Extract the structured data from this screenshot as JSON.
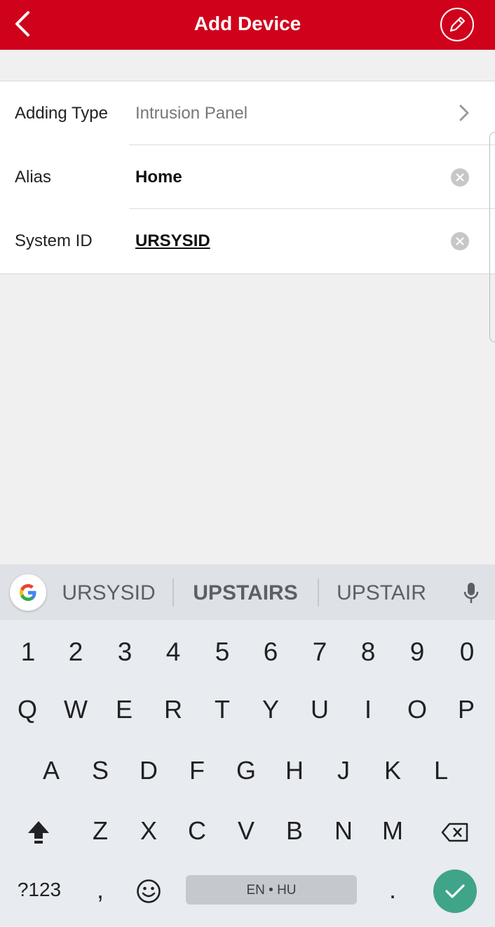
{
  "header": {
    "title": "Add Device",
    "back_icon": "chevron-left-icon",
    "edit_icon": "pencil-icon",
    "color": "#d0021b"
  },
  "form": {
    "rows": [
      {
        "label": "Adding Type",
        "value": "Intrusion Panel",
        "trailing": "chevron-right-icon"
      },
      {
        "label": "Alias",
        "value": "Home",
        "trailing": "clear-icon"
      },
      {
        "label": "System ID",
        "value": "URSYSID",
        "trailing": "clear-icon"
      }
    ]
  },
  "keyboard": {
    "suggestions": [
      "URSYSID",
      "UPSTAIRS",
      "UPSTAIR"
    ],
    "number_row": [
      "1",
      "2",
      "3",
      "4",
      "5",
      "6",
      "7",
      "8",
      "9",
      "0"
    ],
    "row1": [
      "Q",
      "W",
      "E",
      "R",
      "T",
      "Y",
      "U",
      "I",
      "O",
      "P"
    ],
    "row2": [
      "A",
      "S",
      "D",
      "F",
      "G",
      "H",
      "J",
      "K",
      "L"
    ],
    "row3": [
      "Z",
      "X",
      "C",
      "V",
      "B",
      "N",
      "M"
    ],
    "symbols_key": "?123",
    "comma_key": ",",
    "space_label": "EN • HU",
    "period_key": ".",
    "enter_color": "#3fa489"
  }
}
